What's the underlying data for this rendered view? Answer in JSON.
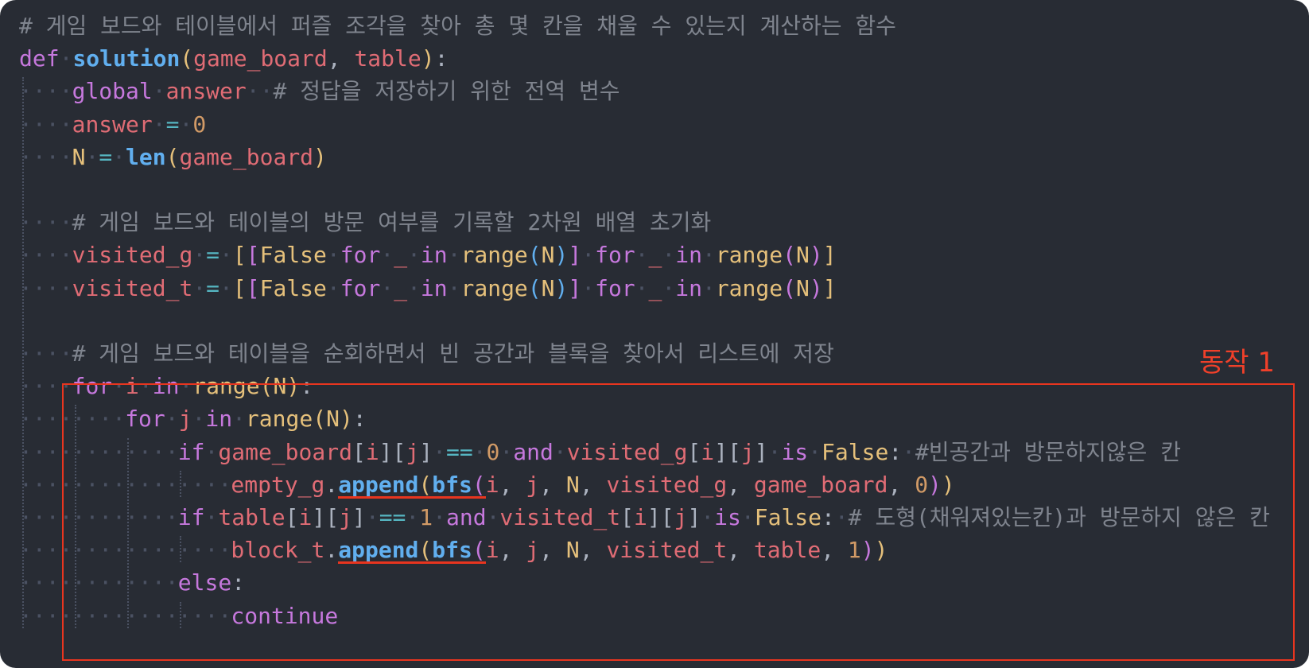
{
  "code": {
    "language": "python",
    "theme_colors": {
      "background": "#282c34",
      "comment": "#7f848e",
      "keyword": "#c678dd",
      "function": "#61afef",
      "variable": "#e06c75",
      "number": "#d19a66",
      "operator": "#56b6c2",
      "constant": "#e5c07b"
    },
    "lines": [
      {
        "indent": 0,
        "tokens": [
          {
            "t": "# 게임 보드와 테이블에서 퍼즐 조각을 찾아 총 몇 칸을 채울 수 있는지 계산하는 함수",
            "c": "cm"
          }
        ]
      },
      {
        "indent": 0,
        "tokens": [
          {
            "t": "def",
            "c": "kw"
          },
          {
            "t": " ",
            "c": "ws"
          },
          {
            "t": "solution",
            "c": "fn"
          },
          {
            "t": "(",
            "c": "br1"
          },
          {
            "t": "game_board",
            "c": "pr"
          },
          {
            "t": ", ",
            "c": "pu"
          },
          {
            "t": "table",
            "c": "pr"
          },
          {
            "t": ")",
            "c": "br1"
          },
          {
            "t": ":",
            "c": "pu"
          }
        ]
      },
      {
        "indent": 1,
        "tokens": [
          {
            "t": "global",
            "c": "kw"
          },
          {
            "t": " ",
            "c": "ws"
          },
          {
            "t": "answer",
            "c": "vr"
          },
          {
            "t": "  ",
            "c": "ws"
          },
          {
            "t": "# 정답을 저장하기 위한 전역 변수",
            "c": "cm"
          }
        ]
      },
      {
        "indent": 1,
        "tokens": [
          {
            "t": "answer",
            "c": "vr"
          },
          {
            "t": " ",
            "c": "ws"
          },
          {
            "t": "=",
            "c": "op"
          },
          {
            "t": " ",
            "c": "ws"
          },
          {
            "t": "0",
            "c": "nm"
          }
        ]
      },
      {
        "indent": 1,
        "tokens": [
          {
            "t": "N",
            "c": "cst"
          },
          {
            "t": " ",
            "c": "ws"
          },
          {
            "t": "=",
            "c": "op"
          },
          {
            "t": " ",
            "c": "ws"
          },
          {
            "t": "len",
            "c": "bi"
          },
          {
            "t": "(",
            "c": "br1"
          },
          {
            "t": "game_board",
            "c": "pr"
          },
          {
            "t": ")",
            "c": "br1"
          }
        ]
      },
      {
        "indent": 0,
        "tokens": []
      },
      {
        "indent": 1,
        "tokens": [
          {
            "t": "# 게임 보드와 테이블의 방문 여부를 기록할 2차원 배열 초기화",
            "c": "cm"
          }
        ]
      },
      {
        "indent": 1,
        "tokens": [
          {
            "t": "visited_g",
            "c": "vr"
          },
          {
            "t": " ",
            "c": "ws"
          },
          {
            "t": "=",
            "c": "op"
          },
          {
            "t": " ",
            "c": "ws"
          },
          {
            "t": "[",
            "c": "br1"
          },
          {
            "t": "[",
            "c": "br2"
          },
          {
            "t": "False",
            "c": "bool"
          },
          {
            "t": " ",
            "c": "ws"
          },
          {
            "t": "for",
            "c": "kw"
          },
          {
            "t": " ",
            "c": "ws"
          },
          {
            "t": "_",
            "c": "vr"
          },
          {
            "t": " ",
            "c": "ws"
          },
          {
            "t": "in",
            "c": "kw"
          },
          {
            "t": " ",
            "c": "ws"
          },
          {
            "t": "range",
            "c": "cst"
          },
          {
            "t": "(",
            "c": "br3"
          },
          {
            "t": "N",
            "c": "cst"
          },
          {
            "t": ")",
            "c": "br3"
          },
          {
            "t": "]",
            "c": "br2"
          },
          {
            "t": " ",
            "c": "ws"
          },
          {
            "t": "for",
            "c": "kw"
          },
          {
            "t": " ",
            "c": "ws"
          },
          {
            "t": "_",
            "c": "vr"
          },
          {
            "t": " ",
            "c": "ws"
          },
          {
            "t": "in",
            "c": "kw"
          },
          {
            "t": " ",
            "c": "ws"
          },
          {
            "t": "range",
            "c": "cst"
          },
          {
            "t": "(",
            "c": "br2"
          },
          {
            "t": "N",
            "c": "cst"
          },
          {
            "t": ")",
            "c": "br2"
          },
          {
            "t": "]",
            "c": "br1"
          }
        ]
      },
      {
        "indent": 1,
        "tokens": [
          {
            "t": "visited_t",
            "c": "vr"
          },
          {
            "t": " ",
            "c": "ws"
          },
          {
            "t": "=",
            "c": "op"
          },
          {
            "t": " ",
            "c": "ws"
          },
          {
            "t": "[",
            "c": "br1"
          },
          {
            "t": "[",
            "c": "br2"
          },
          {
            "t": "False",
            "c": "bool"
          },
          {
            "t": " ",
            "c": "ws"
          },
          {
            "t": "for",
            "c": "kw"
          },
          {
            "t": " ",
            "c": "ws"
          },
          {
            "t": "_",
            "c": "vr"
          },
          {
            "t": " ",
            "c": "ws"
          },
          {
            "t": "in",
            "c": "kw"
          },
          {
            "t": " ",
            "c": "ws"
          },
          {
            "t": "range",
            "c": "cst"
          },
          {
            "t": "(",
            "c": "br3"
          },
          {
            "t": "N",
            "c": "cst"
          },
          {
            "t": ")",
            "c": "br3"
          },
          {
            "t": "]",
            "c": "br2"
          },
          {
            "t": " ",
            "c": "ws"
          },
          {
            "t": "for",
            "c": "kw"
          },
          {
            "t": " ",
            "c": "ws"
          },
          {
            "t": "_",
            "c": "vr"
          },
          {
            "t": " ",
            "c": "ws"
          },
          {
            "t": "in",
            "c": "kw"
          },
          {
            "t": " ",
            "c": "ws"
          },
          {
            "t": "range",
            "c": "cst"
          },
          {
            "t": "(",
            "c": "br2"
          },
          {
            "t": "N",
            "c": "cst"
          },
          {
            "t": ")",
            "c": "br2"
          },
          {
            "t": "]",
            "c": "br1"
          }
        ]
      },
      {
        "indent": 0,
        "tokens": []
      },
      {
        "indent": 1,
        "tokens": [
          {
            "t": "# 게임 보드와 테이블을 순회하면서 빈 공간과 블록을 찾아서 리스트에 저장",
            "c": "cm"
          }
        ]
      },
      {
        "indent": 1,
        "tokens": [
          {
            "t": "for",
            "c": "kw"
          },
          {
            "t": " ",
            "c": "ws"
          },
          {
            "t": "i",
            "c": "vr"
          },
          {
            "t": " ",
            "c": "ws"
          },
          {
            "t": "in",
            "c": "kw"
          },
          {
            "t": " ",
            "c": "ws"
          },
          {
            "t": "range",
            "c": "cst"
          },
          {
            "t": "(",
            "c": "br1"
          },
          {
            "t": "N",
            "c": "cst"
          },
          {
            "t": ")",
            "c": "br1"
          },
          {
            "t": ":",
            "c": "pu"
          }
        ]
      },
      {
        "indent": 2,
        "tokens": [
          {
            "t": "for",
            "c": "kw"
          },
          {
            "t": " ",
            "c": "ws"
          },
          {
            "t": "j",
            "c": "vr"
          },
          {
            "t": " ",
            "c": "ws"
          },
          {
            "t": "in",
            "c": "kw"
          },
          {
            "t": " ",
            "c": "ws"
          },
          {
            "t": "range",
            "c": "cst"
          },
          {
            "t": "(",
            "c": "br1"
          },
          {
            "t": "N",
            "c": "cst"
          },
          {
            "t": ")",
            "c": "br1"
          },
          {
            "t": ":",
            "c": "pu"
          }
        ]
      },
      {
        "indent": 3,
        "tokens": [
          {
            "t": "if",
            "c": "kw"
          },
          {
            "t": " ",
            "c": "ws"
          },
          {
            "t": "game_board",
            "c": "vr"
          },
          {
            "t": "[",
            "c": "tx"
          },
          {
            "t": "i",
            "c": "vr"
          },
          {
            "t": "]",
            "c": "tx"
          },
          {
            "t": "[",
            "c": "tx"
          },
          {
            "t": "j",
            "c": "vr"
          },
          {
            "t": "]",
            "c": "tx"
          },
          {
            "t": " ",
            "c": "ws"
          },
          {
            "t": "==",
            "c": "op"
          },
          {
            "t": " ",
            "c": "ws"
          },
          {
            "t": "0",
            "c": "nm"
          },
          {
            "t": " ",
            "c": "ws"
          },
          {
            "t": "and",
            "c": "kw"
          },
          {
            "t": " ",
            "c": "ws"
          },
          {
            "t": "visited_g",
            "c": "vr"
          },
          {
            "t": "[",
            "c": "tx"
          },
          {
            "t": "i",
            "c": "vr"
          },
          {
            "t": "]",
            "c": "tx"
          },
          {
            "t": "[",
            "c": "tx"
          },
          {
            "t": "j",
            "c": "vr"
          },
          {
            "t": "]",
            "c": "tx"
          },
          {
            "t": " ",
            "c": "ws"
          },
          {
            "t": "is",
            "c": "kw"
          },
          {
            "t": " ",
            "c": "ws"
          },
          {
            "t": "False",
            "c": "bool"
          },
          {
            "t": ":",
            "c": "pu"
          },
          {
            "t": " ",
            "c": "ws"
          },
          {
            "t": "#빈공간과 방문하지않은 칸",
            "c": "cm"
          }
        ]
      },
      {
        "indent": 4,
        "tokens": [
          {
            "t": "empty_g",
            "c": "vr"
          },
          {
            "t": ".",
            "c": "pu"
          },
          {
            "t": "append",
            "c": "fn",
            "u": 1
          },
          {
            "t": "(",
            "c": "br1",
            "u": 1
          },
          {
            "t": "bfs",
            "c": "fn",
            "u": 2
          },
          {
            "t": "(",
            "c": "br2",
            "u": 2
          },
          {
            "t": "i",
            "c": "vr"
          },
          {
            "t": ", ",
            "c": "pu"
          },
          {
            "t": "j",
            "c": "vr"
          },
          {
            "t": ", ",
            "c": "pu"
          },
          {
            "t": "N",
            "c": "cst"
          },
          {
            "t": ", ",
            "c": "pu"
          },
          {
            "t": "visited_g",
            "c": "vr"
          },
          {
            "t": ", ",
            "c": "pu"
          },
          {
            "t": "game_board",
            "c": "vr"
          },
          {
            "t": ", ",
            "c": "pu"
          },
          {
            "t": "0",
            "c": "nm"
          },
          {
            "t": ")",
            "c": "br2"
          },
          {
            "t": ")",
            "c": "br1"
          }
        ]
      },
      {
        "indent": 3,
        "tokens": [
          {
            "t": "if",
            "c": "kw"
          },
          {
            "t": " ",
            "c": "ws"
          },
          {
            "t": "table",
            "c": "vr"
          },
          {
            "t": "[",
            "c": "tx"
          },
          {
            "t": "i",
            "c": "vr"
          },
          {
            "t": "]",
            "c": "tx"
          },
          {
            "t": "[",
            "c": "tx"
          },
          {
            "t": "j",
            "c": "vr"
          },
          {
            "t": "]",
            "c": "tx"
          },
          {
            "t": " ",
            "c": "ws"
          },
          {
            "t": "==",
            "c": "op"
          },
          {
            "t": " ",
            "c": "ws"
          },
          {
            "t": "1",
            "c": "nm"
          },
          {
            "t": " ",
            "c": "ws"
          },
          {
            "t": "and",
            "c": "kw"
          },
          {
            "t": " ",
            "c": "ws"
          },
          {
            "t": "visited_t",
            "c": "vr"
          },
          {
            "t": "[",
            "c": "tx"
          },
          {
            "t": "i",
            "c": "vr"
          },
          {
            "t": "]",
            "c": "tx"
          },
          {
            "t": "[",
            "c": "tx"
          },
          {
            "t": "j",
            "c": "vr"
          },
          {
            "t": "]",
            "c": "tx"
          },
          {
            "t": " ",
            "c": "ws"
          },
          {
            "t": "is",
            "c": "kw"
          },
          {
            "t": " ",
            "c": "ws"
          },
          {
            "t": "False",
            "c": "bool"
          },
          {
            "t": ":",
            "c": "pu"
          },
          {
            "t": " ",
            "c": "ws"
          },
          {
            "t": "# 도형(채워져있는칸)과 방문하지 않은 칸",
            "c": "cm"
          }
        ]
      },
      {
        "indent": 4,
        "tokens": [
          {
            "t": "block_t",
            "c": "vr"
          },
          {
            "t": ".",
            "c": "pu"
          },
          {
            "t": "append",
            "c": "fn",
            "u": 1
          },
          {
            "t": "(",
            "c": "br1",
            "u": 1
          },
          {
            "t": "bfs",
            "c": "fn",
            "u": 2
          },
          {
            "t": "(",
            "c": "br2",
            "u": 2
          },
          {
            "t": "i",
            "c": "vr"
          },
          {
            "t": ", ",
            "c": "pu"
          },
          {
            "t": "j",
            "c": "vr"
          },
          {
            "t": ", ",
            "c": "pu"
          },
          {
            "t": "N",
            "c": "cst"
          },
          {
            "t": ", ",
            "c": "pu"
          },
          {
            "t": "visited_t",
            "c": "vr"
          },
          {
            "t": ", ",
            "c": "pu"
          },
          {
            "t": "table",
            "c": "vr"
          },
          {
            "t": ", ",
            "c": "pu"
          },
          {
            "t": "1",
            "c": "nm"
          },
          {
            "t": ")",
            "c": "br2"
          },
          {
            "t": ")",
            "c": "br1"
          }
        ]
      },
      {
        "indent": 3,
        "tokens": [
          {
            "t": "else",
            "c": "kw"
          },
          {
            "t": ":",
            "c": "pu"
          }
        ]
      },
      {
        "indent": 4,
        "tokens": [
          {
            "t": "continue",
            "c": "kw"
          }
        ]
      }
    ]
  },
  "annotation": {
    "label": "동작 1",
    "color": "#e8351f"
  }
}
